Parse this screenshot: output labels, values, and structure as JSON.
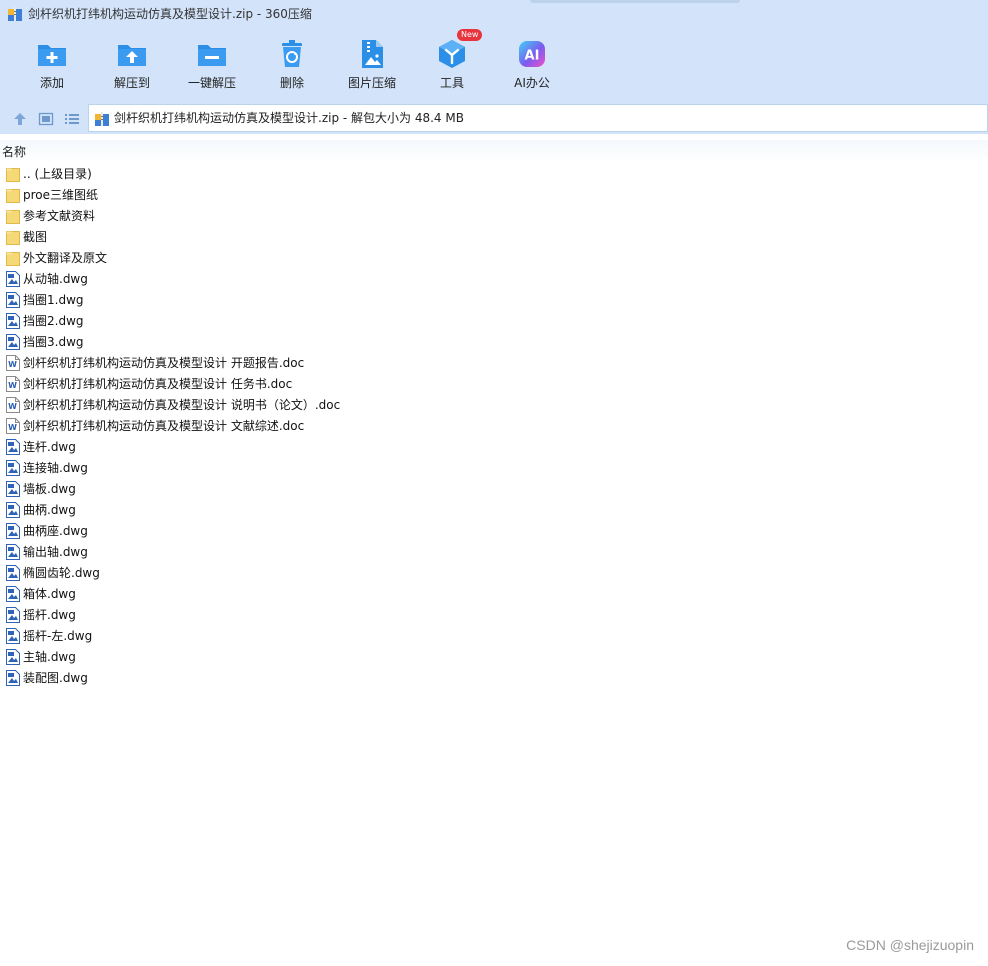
{
  "window": {
    "title": "剑杆织机打纬机构运动仿真及模型设计.zip - 360压缩"
  },
  "toolbar": [
    {
      "label": "添加",
      "icon": "add-folder-icon"
    },
    {
      "label": "解压到",
      "icon": "extract-to-icon"
    },
    {
      "label": "一键解压",
      "icon": "one-click-extract-icon"
    },
    {
      "label": "删除",
      "icon": "recycle-delete-icon"
    },
    {
      "label": "图片压缩",
      "icon": "image-compress-icon"
    },
    {
      "label": "工具",
      "icon": "tools-cube-icon",
      "badge": "New"
    },
    {
      "label": "AI办公",
      "icon": "ai-office-icon",
      "glyph": "AI"
    }
  ],
  "address": {
    "text": "剑杆织机打纬机构运动仿真及模型设计.zip - 解包大小为 48.4 MB"
  },
  "columns": {
    "name": "名称"
  },
  "files": [
    {
      "name": ".. (上级目录)",
      "type": "folder"
    },
    {
      "name": "proe三维图纸",
      "type": "folder"
    },
    {
      "name": "参考文献资料",
      "type": "folder"
    },
    {
      "name": "截图",
      "type": "folder"
    },
    {
      "name": "外文翻译及原文",
      "type": "folder"
    },
    {
      "name": "从动轴.dwg",
      "type": "dwg"
    },
    {
      "name": "挡圈1.dwg",
      "type": "dwg"
    },
    {
      "name": "挡圈2.dwg",
      "type": "dwg"
    },
    {
      "name": "挡圈3.dwg",
      "type": "dwg"
    },
    {
      "name": "剑杆织机打纬机构运动仿真及模型设计 开题报告.doc",
      "type": "doc"
    },
    {
      "name": "剑杆织机打纬机构运动仿真及模型设计 任务书.doc",
      "type": "doc"
    },
    {
      "name": "剑杆织机打纬机构运动仿真及模型设计 说明书（论文）.doc",
      "type": "doc"
    },
    {
      "name": "剑杆织机打纬机构运动仿真及模型设计 文献综述.doc",
      "type": "doc"
    },
    {
      "name": "连杆.dwg",
      "type": "dwg"
    },
    {
      "name": "连接轴.dwg",
      "type": "dwg"
    },
    {
      "name": "墙板.dwg",
      "type": "dwg"
    },
    {
      "name": "曲柄.dwg",
      "type": "dwg"
    },
    {
      "name": "曲柄座.dwg",
      "type": "dwg"
    },
    {
      "name": "输出轴.dwg",
      "type": "dwg"
    },
    {
      "name": "椭圆齿轮.dwg",
      "type": "dwg"
    },
    {
      "name": "箱体.dwg",
      "type": "dwg"
    },
    {
      "name": "摇杆.dwg",
      "type": "dwg"
    },
    {
      "name": "摇杆-左.dwg",
      "type": "dwg"
    },
    {
      "name": "主轴.dwg",
      "type": "dwg"
    },
    {
      "name": "装配图.dwg",
      "type": "dwg"
    }
  ],
  "watermark": "CSDN @shejizuopin",
  "colors": {
    "toolbar_bg": "#d3e4fa",
    "accent_blue": "#2b8fe8",
    "folder_yellow": "#f6d977",
    "badge_red": "#e8343c"
  }
}
